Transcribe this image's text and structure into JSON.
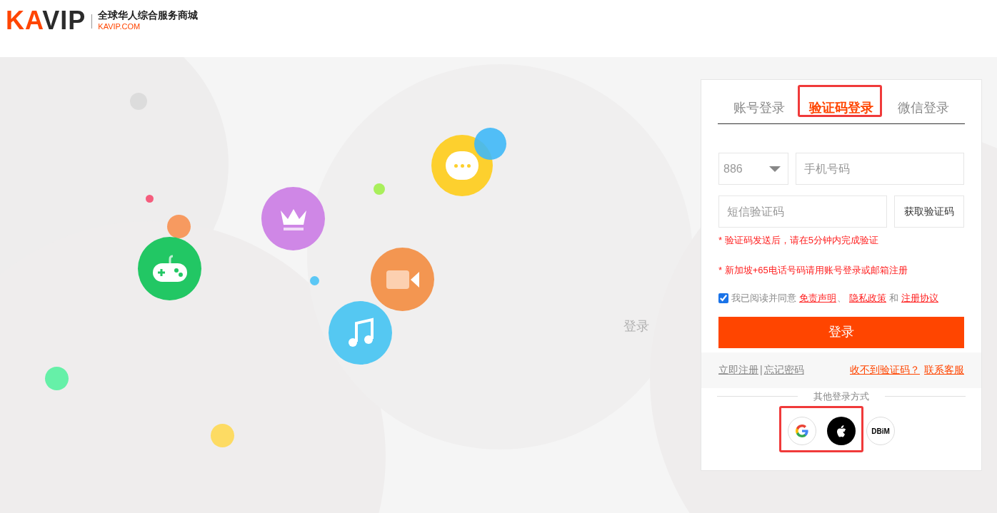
{
  "header": {
    "logo": {
      "part_1": "KA",
      "part_2": "VIP"
    },
    "slogan": "全球华人综合服务商城",
    "domain": "KAVIP.COM"
  },
  "ghost_label": "登录",
  "login": {
    "tabs": [
      {
        "label": "账号登录",
        "selected": false
      },
      {
        "label": "验证码登录",
        "selected": true
      },
      {
        "label": "微信登录",
        "selected": false
      }
    ],
    "country_code": {
      "value": "886"
    },
    "phone": {
      "placeholder": "手机号码"
    },
    "sms_code": {
      "placeholder": "短信验证码"
    },
    "get_code_button": "获取验证码",
    "notices": [
      "* 验证码发送后，请在5分钟内完成验证",
      "* 新加坡+65电话号码请用账号登录或邮箱注册"
    ],
    "agreement": {
      "checked": true,
      "text": "我已阅读并同意",
      "links": [
        "免责声明",
        "隐私政策",
        "注册协议"
      ],
      "separator": "、",
      "conjunction": "和"
    },
    "submit": "登录",
    "footer_links_left": [
      "立即注册",
      "忘记密码"
    ],
    "footer_divider": "|",
    "footer_links_right": [
      "收不到验证码？",
      "联系客服"
    ],
    "other_methods_label": "其他登录方式",
    "social": [
      {
        "kind": "google"
      },
      {
        "kind": "apple"
      },
      {
        "kind": "dbim",
        "label": "DBiM"
      }
    ]
  }
}
